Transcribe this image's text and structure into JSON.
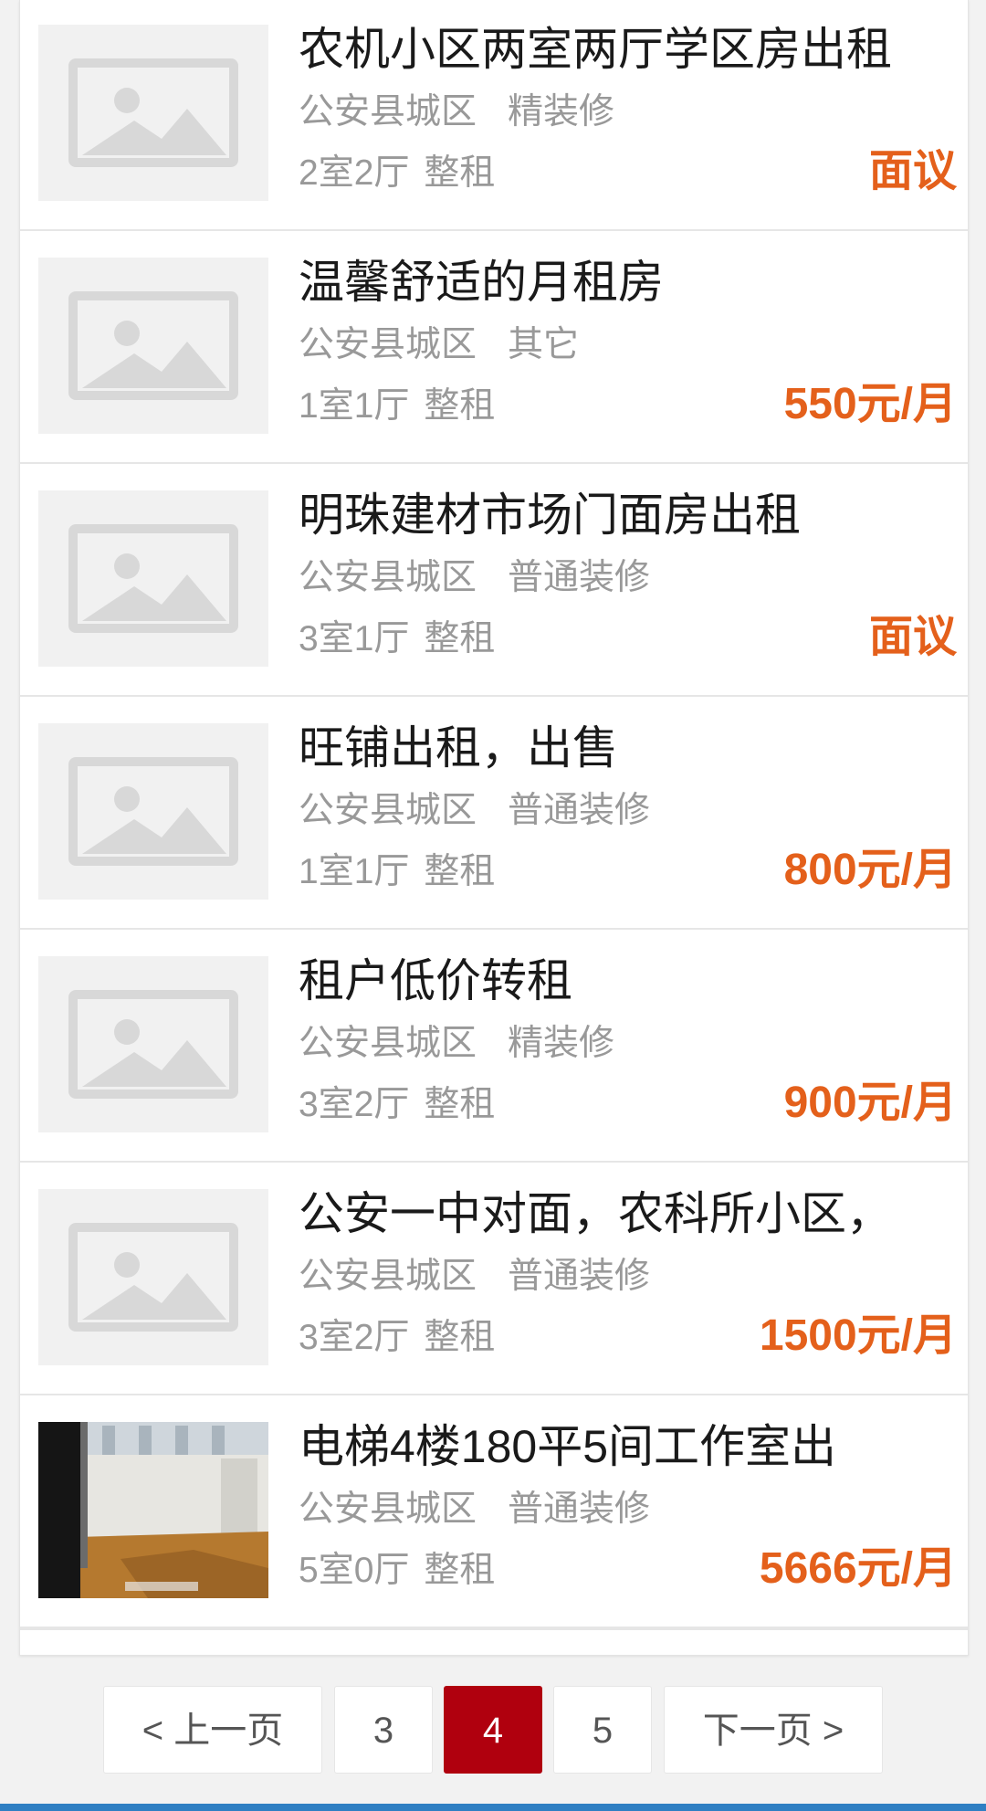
{
  "listings": [
    {
      "title": "农机小区两室两厅学区房出租",
      "area": "公安县城区",
      "decor": "精装修",
      "layout": "2室2厅",
      "type": "整租",
      "price": "面议",
      "photo": false
    },
    {
      "title": "温馨舒适的月租房",
      "area": "公安县城区",
      "decor": "其它",
      "layout": "1室1厅",
      "type": "整租",
      "price": "550元/月",
      "photo": false
    },
    {
      "title": "明珠建材市场门面房出租",
      "area": "公安县城区",
      "decor": "普通装修",
      "layout": "3室1厅",
      "type": "整租",
      "price": "面议",
      "photo": false
    },
    {
      "title": "旺铺出租，出售",
      "area": "公安县城区",
      "decor": "普通装修",
      "layout": "1室1厅",
      "type": "整租",
      "price": "800元/月",
      "photo": false
    },
    {
      "title": "租户低价转租",
      "area": "公安县城区",
      "decor": "精装修",
      "layout": "3室2厅",
      "type": "整租",
      "price": "900元/月",
      "photo": false
    },
    {
      "title": "公安一中对面，农科所小区，",
      "area": "公安县城区",
      "decor": "普通装修",
      "layout": "3室2厅",
      "type": "整租",
      "price": "1500元/月",
      "photo": false
    },
    {
      "title": "电梯4楼180平5间工作室出",
      "area": "公安县城区",
      "decor": "普通装修",
      "layout": "5室0厅",
      "type": "整租",
      "price": "5666元/月",
      "photo": true
    }
  ],
  "pagination": {
    "prev_label": "< 上一页",
    "pages": [
      "3",
      "4",
      "5"
    ],
    "current_page": "4",
    "next_label": "下一页 >"
  },
  "colors": {
    "price": "#e4601b",
    "active_page": "#b0000e",
    "bottom_bar": "#2f7fc3"
  },
  "icons": {
    "placeholder": "image-placeholder-icon",
    "photo": "office-room-photo"
  }
}
